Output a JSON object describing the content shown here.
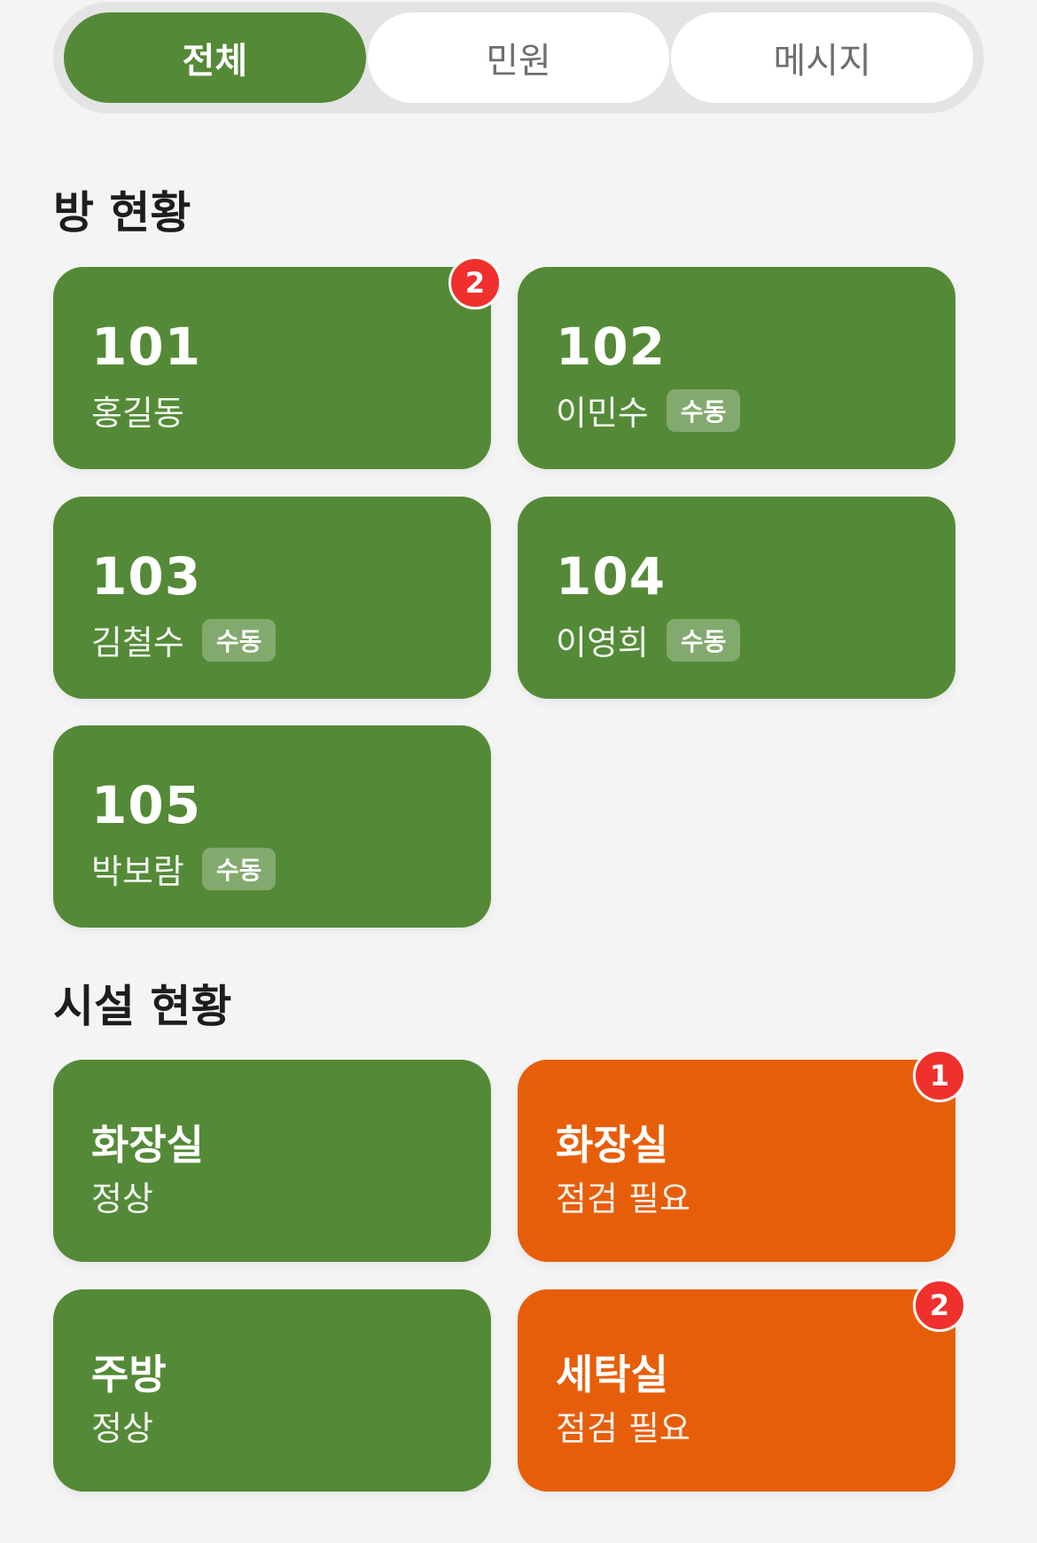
{
  "tabs": [
    {
      "label": "전체",
      "active": true
    },
    {
      "label": "민원",
      "active": false
    },
    {
      "label": "메시지",
      "active": false
    }
  ],
  "rooms_section": {
    "title": "방 현황",
    "rooms": [
      {
        "number": "101",
        "resident": "홍길동",
        "tag": "",
        "badge": "2"
      },
      {
        "number": "102",
        "resident": "이민수",
        "tag": "수동",
        "badge": ""
      },
      {
        "number": "103",
        "resident": "김철수",
        "tag": "수동",
        "badge": ""
      },
      {
        "number": "104",
        "resident": "이영희",
        "tag": "수동",
        "badge": ""
      },
      {
        "number": "105",
        "resident": "박보람",
        "tag": "수동",
        "badge": ""
      }
    ]
  },
  "facilities_section": {
    "title": "시설 현황",
    "facilities": [
      {
        "name": "화장실",
        "status": "정상",
        "badge": ""
      },
      {
        "name": "화장실",
        "status": "점검 필요",
        "badge": "1"
      },
      {
        "name": "주방",
        "status": "정상",
        "badge": ""
      },
      {
        "name": "세탁실",
        "status": "점검 필요",
        "badge": "2"
      }
    ]
  },
  "colors": {
    "normal": "#548a37",
    "warning": "#e75e0a",
    "badge": "#f0302c",
    "background": "#f4f4f4"
  }
}
